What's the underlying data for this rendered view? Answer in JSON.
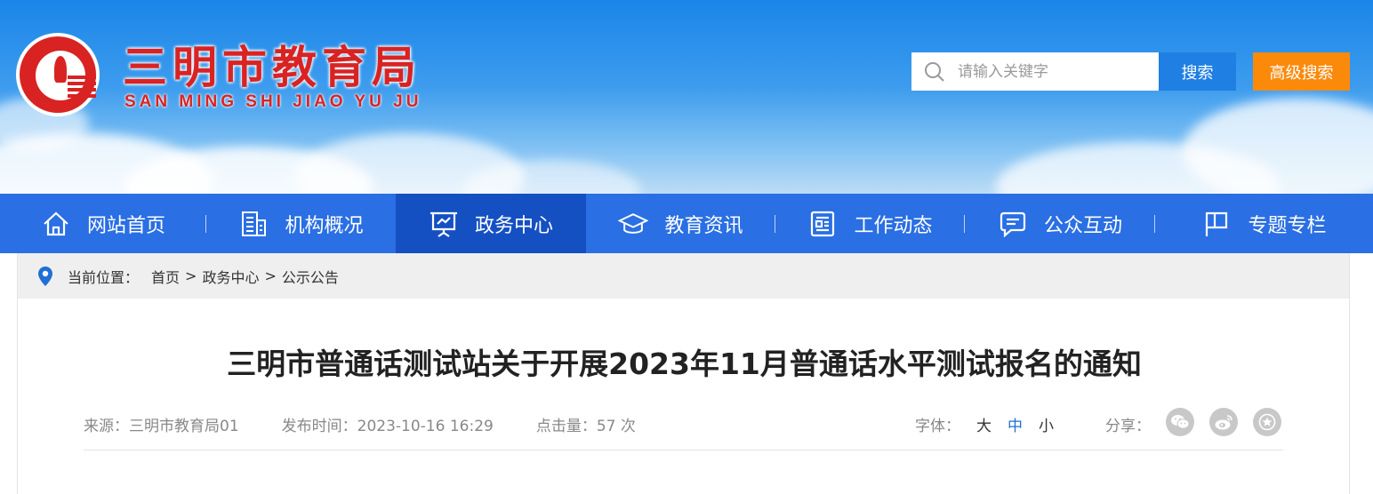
{
  "header": {
    "site_title": "三明市教育局",
    "site_subtitle": "SAN MING SHI JIAO YU JU",
    "brand_color": "#d92323",
    "search": {
      "placeholder": "请输入关键字",
      "button_label": "搜索",
      "advanced_label": "高级搜索"
    }
  },
  "nav": {
    "items": [
      {
        "label": "网站首页",
        "icon": "home-icon"
      },
      {
        "label": "机构概况",
        "icon": "building-icon"
      },
      {
        "label": "政务中心",
        "icon": "presentation-icon",
        "active": true
      },
      {
        "label": "教育资讯",
        "icon": "graduation-cap-icon"
      },
      {
        "label": "工作动态",
        "icon": "news-icon"
      },
      {
        "label": "公众互动",
        "icon": "chat-icon"
      },
      {
        "label": "专题专栏",
        "icon": "flag-icon"
      }
    ]
  },
  "breadcrumb": {
    "label": "当前位置：",
    "items": [
      "首页",
      "政务中心",
      "公示公告"
    ],
    "separator": ">"
  },
  "article": {
    "title": "三明市普通话测试站关于开展2023年11月普通话水平测试报名的通知",
    "source": "来源：三明市教育局01",
    "published": "发布时间：2023-10-16 16:29",
    "views": "点击量：57 次",
    "font_label": "字体：",
    "font_sizes": [
      "大",
      "中",
      "小"
    ],
    "share_label": "分享："
  },
  "share_icons": [
    "wechat-icon",
    "weibo-icon",
    "favorite-icon"
  ]
}
